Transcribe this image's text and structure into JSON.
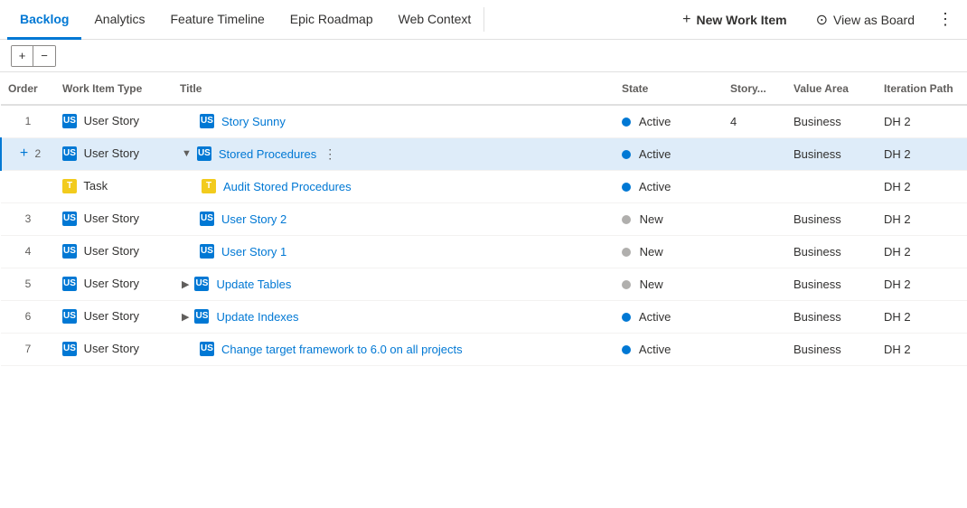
{
  "nav": {
    "tabs": [
      {
        "id": "backlog",
        "label": "Backlog",
        "active": true
      },
      {
        "id": "analytics",
        "label": "Analytics",
        "active": false
      },
      {
        "id": "feature-timeline",
        "label": "Feature Timeline",
        "active": false
      },
      {
        "id": "epic-roadmap",
        "label": "Epic Roadmap",
        "active": false
      },
      {
        "id": "web-context",
        "label": "Web Context",
        "active": false
      }
    ],
    "new_work_item_label": "New Work Item",
    "view_as_board_label": "View as Board",
    "more_icon": "⋮"
  },
  "toolbar": {
    "expand_icon": "+",
    "collapse_icon": "−"
  },
  "table": {
    "columns": [
      {
        "id": "order",
        "label": "Order"
      },
      {
        "id": "work-item-type",
        "label": "Work Item Type"
      },
      {
        "id": "title",
        "label": "Title"
      },
      {
        "id": "state",
        "label": "State"
      },
      {
        "id": "story-points",
        "label": "Story..."
      },
      {
        "id": "value-area",
        "label": "Value Area"
      },
      {
        "id": "iteration-path",
        "label": "Iteration Path"
      }
    ],
    "rows": [
      {
        "id": "row-1",
        "order": "1",
        "type": "User Story",
        "type_icon": "US",
        "type_color": "user-story",
        "has_children": false,
        "expanded": false,
        "is_child": false,
        "title": "Story Sunny",
        "state": "Active",
        "state_type": "active",
        "story_points": "4",
        "value_area": "Business",
        "iteration_path": "DH 2"
      },
      {
        "id": "row-2",
        "order": "2",
        "type": "User Story",
        "type_icon": "US",
        "type_color": "user-story",
        "has_children": true,
        "expanded": true,
        "is_child": false,
        "selected": true,
        "title": "Stored Procedures",
        "state": "Active",
        "state_type": "active",
        "story_points": "",
        "value_area": "Business",
        "iteration_path": "DH 2"
      },
      {
        "id": "row-2-1",
        "order": "",
        "type": "Task",
        "type_icon": "T",
        "type_color": "task",
        "has_children": false,
        "expanded": false,
        "is_child": true,
        "title": "Audit Stored Procedures",
        "state": "Active",
        "state_type": "active",
        "story_points": "",
        "value_area": "",
        "iteration_path": "DH 2"
      },
      {
        "id": "row-3",
        "order": "3",
        "type": "User Story",
        "type_icon": "US",
        "type_color": "user-story",
        "has_children": false,
        "expanded": false,
        "is_child": false,
        "title": "User Story 2",
        "state": "New",
        "state_type": "new",
        "story_points": "",
        "value_area": "Business",
        "iteration_path": "DH 2"
      },
      {
        "id": "row-4",
        "order": "4",
        "type": "User Story",
        "type_icon": "US",
        "type_color": "user-story",
        "has_children": false,
        "expanded": false,
        "is_child": false,
        "title": "User Story 1",
        "state": "New",
        "state_type": "new",
        "story_points": "",
        "value_area": "Business",
        "iteration_path": "DH 2"
      },
      {
        "id": "row-5",
        "order": "5",
        "type": "User Story",
        "type_icon": "US",
        "type_color": "user-story",
        "has_children": true,
        "expanded": false,
        "is_child": false,
        "title": "Update Tables",
        "state": "New",
        "state_type": "new",
        "story_points": "",
        "value_area": "Business",
        "iteration_path": "DH 2"
      },
      {
        "id": "row-6",
        "order": "6",
        "type": "User Story",
        "type_icon": "US",
        "type_color": "user-story",
        "has_children": true,
        "expanded": false,
        "is_child": false,
        "title": "Update Indexes",
        "state": "Active",
        "state_type": "active",
        "story_points": "",
        "value_area": "Business",
        "iteration_path": "DH 2"
      },
      {
        "id": "row-7",
        "order": "7",
        "type": "User Story",
        "type_icon": "US",
        "type_color": "user-story",
        "has_children": false,
        "expanded": false,
        "is_child": false,
        "title": "Change target framework to 6.0 on all projects",
        "state": "Active",
        "state_type": "active",
        "story_points": "",
        "value_area": "Business",
        "iteration_path": "DH 2"
      }
    ]
  }
}
